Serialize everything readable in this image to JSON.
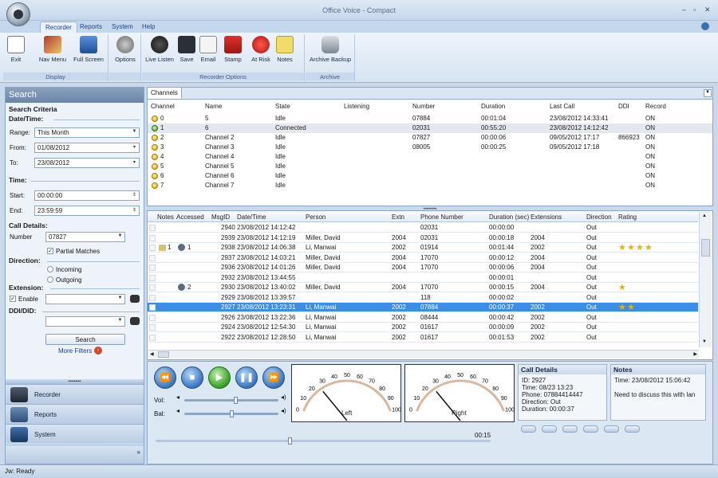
{
  "window": {
    "title": "Office Voice - Compact",
    "controls": [
      "–",
      "▫",
      "✕"
    ]
  },
  "ribbon_tabs": [
    "Recorder",
    "Reports",
    "System",
    "Help"
  ],
  "ribbon": {
    "groups": [
      {
        "label": "Display",
        "buttons": [
          "Exit",
          "Nav Menu",
          "Full Screen"
        ]
      },
      {
        "label": "",
        "buttons": [
          "Options"
        ]
      },
      {
        "label": "Recorder Options",
        "buttons": [
          "Live Listen",
          "Save",
          "Email",
          "Stamp",
          "At Risk",
          "Notes"
        ]
      },
      {
        "label": "Archive",
        "buttons": [
          "Archive Backup"
        ]
      }
    ]
  },
  "search": {
    "header": "Search",
    "criteria": "Search Criteria",
    "datetime_section": "Date/Time:",
    "range_label": "Range:",
    "range_value": "This Month",
    "from_label": "From:",
    "from_value": "01/08/2012",
    "to_label": "To:",
    "to_value": "23/08/2012",
    "time_section": "Time:",
    "start_label": "Start:",
    "start_value": "00:00:00",
    "end_label": "End:",
    "end_value": "23:59:59",
    "call_details_section": "Call Details:",
    "number_label": "Number",
    "number_value": "07827",
    "partial_matches": "Partial Matches",
    "direction_section": "Direction:",
    "incoming": "Incoming",
    "outgoing": "Outgoing",
    "extension_section": "Extension:",
    "enable": "Enable",
    "ddi_section": "DDI/DID:",
    "search_button": "Search",
    "more_filters": "More Filters"
  },
  "nav": [
    "Recorder",
    "Reports",
    "System"
  ],
  "channels": {
    "tab": "Channels",
    "columns": [
      "Channel",
      "Name",
      "State",
      "Listening",
      "Number",
      "Duration",
      "Last Call",
      "DDI",
      "Record"
    ],
    "rows": [
      {
        "ch": "0",
        "name": "5",
        "state": "Idle",
        "listening": "",
        "number": "07884",
        "duration": "00:01:04",
        "last": "23/08/2012 14:33:41",
        "ddi": "",
        "record": "ON",
        "color": "#d2a20d"
      },
      {
        "ch": "1",
        "name": "6",
        "state": "Connected",
        "listening": "",
        "number": "02031",
        "duration": "00:55:20",
        "last": "23/08/2012 14:12:42",
        "ddi": "",
        "record": "ON",
        "color": "#4d9b2d"
      },
      {
        "ch": "2",
        "name": "Channel 2",
        "state": "Idle",
        "listening": "",
        "number": "07827",
        "duration": "00:00:06",
        "last": "09/05/2012 17:17",
        "ddi": "866923",
        "record": "ON",
        "color": "#d2a20d"
      },
      {
        "ch": "3",
        "name": "Channel 3",
        "state": "Idle",
        "listening": "",
        "number": "08005",
        "duration": "00:00:25",
        "last": "09/05/2012 17:18",
        "ddi": "",
        "record": "ON",
        "color": "#d2a20d"
      },
      {
        "ch": "4",
        "name": "Channel 4",
        "state": "Idle",
        "listening": "",
        "number": "",
        "duration": "",
        "last": "",
        "ddi": "",
        "record": "ON",
        "color": "#d2a20d"
      },
      {
        "ch": "5",
        "name": "Channel 5",
        "state": "Idle",
        "listening": "",
        "number": "",
        "duration": "",
        "last": "",
        "ddi": "",
        "record": "ON",
        "color": "#d2a20d"
      },
      {
        "ch": "6",
        "name": "Channel 6",
        "state": "Idle",
        "listening": "",
        "number": "",
        "duration": "",
        "last": "",
        "ddi": "",
        "record": "ON",
        "color": "#d2a20d"
      },
      {
        "ch": "7",
        "name": "Channel 7",
        "state": "Idle",
        "listening": "",
        "number": "",
        "duration": "",
        "last": "",
        "ddi": "",
        "record": "ON",
        "color": "#d2a20d"
      }
    ]
  },
  "calls": {
    "columns": [
      "Notes",
      "Accessed",
      "MsgID",
      "Date/Time",
      "Person",
      "Extn",
      "Phone Number",
      "Duration (sec)",
      "Extensions",
      "Direction",
      "Rating"
    ],
    "rows": [
      {
        "notes": "",
        "accessed": "",
        "id": "2940",
        "dt": "23/08/2012 14:12:42",
        "person": "",
        "extn": "",
        "phone": "02031",
        "dur": "00:00:00",
        "exts": "",
        "dir": "Out",
        "rating": 0
      },
      {
        "notes": "",
        "accessed": "",
        "id": "2939",
        "dt": "23/08/2012 14:12:19",
        "person": "Miller, David",
        "extn": "2004",
        "phone": "02031",
        "dur": "00:00:18",
        "exts": "2004",
        "dir": "Out",
        "rating": 0
      },
      {
        "notes": "1",
        "accessed": "1",
        "id": "2938",
        "dt": "23/08/2012 14:06:38",
        "person": "Li, Manwai",
        "extn": "2002",
        "phone": "01914",
        "dur": "00:01:44",
        "exts": "2002",
        "dir": "Out",
        "rating": 4
      },
      {
        "notes": "",
        "accessed": "",
        "id": "2937",
        "dt": "23/08/2012 14:03:21",
        "person": "Miller, David",
        "extn": "2004",
        "phone": "17070",
        "dur": "00:00:12",
        "exts": "2004",
        "dir": "Out",
        "rating": 0
      },
      {
        "notes": "",
        "accessed": "",
        "id": "2936",
        "dt": "23/08/2012 14:01:26",
        "person": "Miller, David",
        "extn": "2004",
        "phone": "17070",
        "dur": "00:00:06",
        "exts": "2004",
        "dir": "Out",
        "rating": 0
      },
      {
        "notes": "",
        "accessed": "",
        "id": "2932",
        "dt": "23/08/2012 13:44:55",
        "person": "",
        "extn": "",
        "phone": "",
        "dur": "00:00:01",
        "exts": "",
        "dir": "Out",
        "rating": 0
      },
      {
        "notes": "",
        "accessed": "2",
        "id": "2930",
        "dt": "23/08/2012 13:40:02",
        "person": "Miller, David",
        "extn": "2004",
        "phone": "17070",
        "dur": "00:00:15",
        "exts": "2004",
        "dir": "Out",
        "rating": 1
      },
      {
        "notes": "",
        "accessed": "",
        "id": "2929",
        "dt": "23/08/2012 13:39:57",
        "person": "",
        "extn": "",
        "phone": "118",
        "dur": "00:00:02",
        "exts": "",
        "dir": "Out",
        "rating": 0
      },
      {
        "notes": "",
        "accessed": "",
        "id": "2927",
        "dt": "23/08/2012 13:23:31",
        "person": "Li, Manwai",
        "extn": "2002",
        "phone": "07884",
        "dur": "00:00:37",
        "exts": "2002",
        "dir": "Out",
        "rating": 2,
        "selected": true
      },
      {
        "notes": "",
        "accessed": "",
        "id": "2926",
        "dt": "23/08/2012 13:22:36",
        "person": "Li, Manwai",
        "extn": "2002",
        "phone": "08444",
        "dur": "00:00:42",
        "exts": "2002",
        "dir": "Out",
        "rating": 0
      },
      {
        "notes": "",
        "accessed": "",
        "id": "2924",
        "dt": "23/08/2012 12:54:30",
        "person": "Li, Manwai",
        "extn": "2002",
        "phone": "01617",
        "dur": "00:00:09",
        "exts": "2002",
        "dir": "Out",
        "rating": 0
      },
      {
        "notes": "",
        "accessed": "",
        "id": "2922",
        "dt": "23/08/2012 12:28:50",
        "person": "Li, Manwai",
        "extn": "2002",
        "phone": "01617",
        "dur": "00:01:53",
        "exts": "2002",
        "dir": "Out",
        "rating": 0
      }
    ]
  },
  "player": {
    "vol_label": "Vol:",
    "bal_label": "Bal:",
    "vol_level": 0.55,
    "bal_level": 0.5,
    "position_time": "00:15",
    "position_fraction": 0.4,
    "meter_scale": [
      "0",
      "10",
      "20",
      "30",
      "40",
      "50",
      "60",
      "70",
      "80",
      "90",
      "100"
    ],
    "meter_left": "Left",
    "meter_right": "Right"
  },
  "call_details": {
    "title": "Call Details",
    "lines": [
      "ID: 2927",
      "Time: 08/23 13:23",
      "Phone: 07884414447",
      "Direction: Out",
      "Duration: 00:00:37"
    ]
  },
  "notes_panel": {
    "title": "Notes",
    "lines": [
      "Time: 23/08/2012 15:06:42",
      "",
      "Need to discuss this with Ian"
    ]
  },
  "status": "Jw: Ready"
}
